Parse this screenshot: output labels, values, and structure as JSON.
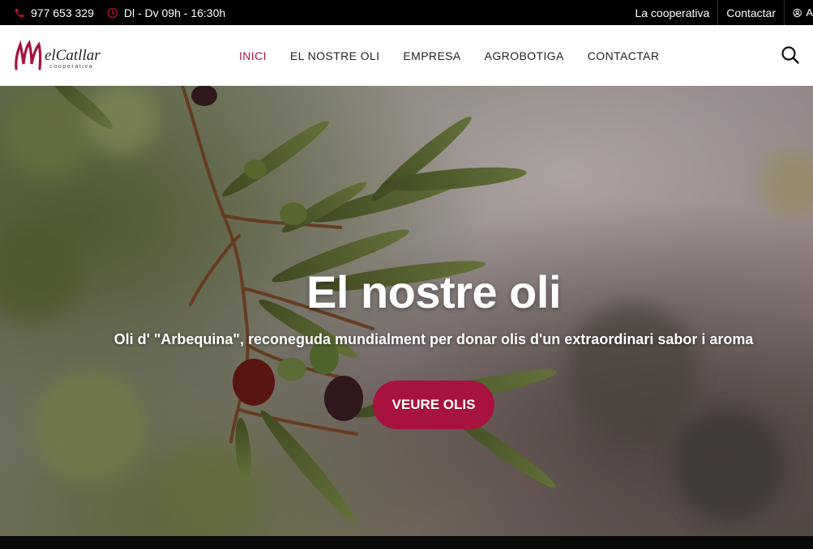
{
  "topbar": {
    "phone": "977 653 329",
    "hours": "Dl - Dv 09h - 16:30h",
    "links": [
      "La cooperativa",
      "Contactar"
    ],
    "account_label": "A"
  },
  "brand": {
    "name": "elCatllar",
    "tagline": "cooperativa",
    "color": "#a8123e"
  },
  "nav": {
    "items": [
      "INICI",
      "EL NOSTRE OLI",
      "EMPRESA",
      "AGROBOTIGA",
      "CONTACTAR"
    ],
    "active": "INICI"
  },
  "hero": {
    "title": "El nostre oli",
    "subtitle": "Oli d' \"Arbequina\", reconeguda mundialment per donar olis d'un extraordinari sabor i aroma",
    "cta": "VEURE OLIS"
  },
  "colors": {
    "accent": "#a8123e",
    "topbar": "#000000"
  },
  "icons": {
    "phone": "phone-icon",
    "clock": "clock-icon",
    "account": "user-icon",
    "search": "search-icon"
  }
}
